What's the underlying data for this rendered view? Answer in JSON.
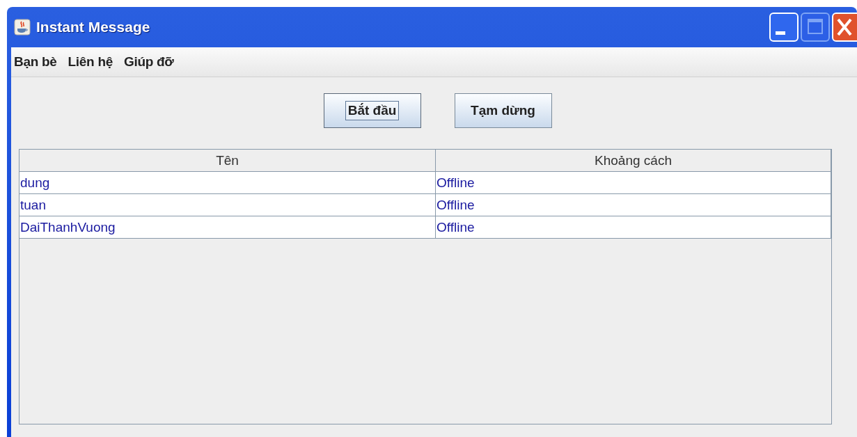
{
  "window": {
    "title": "Instant Message"
  },
  "menu": [
    {
      "label": "Bạn bè"
    },
    {
      "label": "Liên hệ"
    },
    {
      "label": "Giúp đỡ"
    }
  ],
  "buttons": [
    {
      "label": "Bắt đầu",
      "focused": true
    },
    {
      "label": "Tạm dừng",
      "focused": false
    }
  ],
  "table": {
    "columns": [
      "Tên",
      "Khoảng cách"
    ],
    "rows": [
      [
        "dung",
        "Offline"
      ],
      [
        "tuan",
        "Offline"
      ],
      [
        "DaiThanhVuong",
        "Offline"
      ]
    ]
  }
}
